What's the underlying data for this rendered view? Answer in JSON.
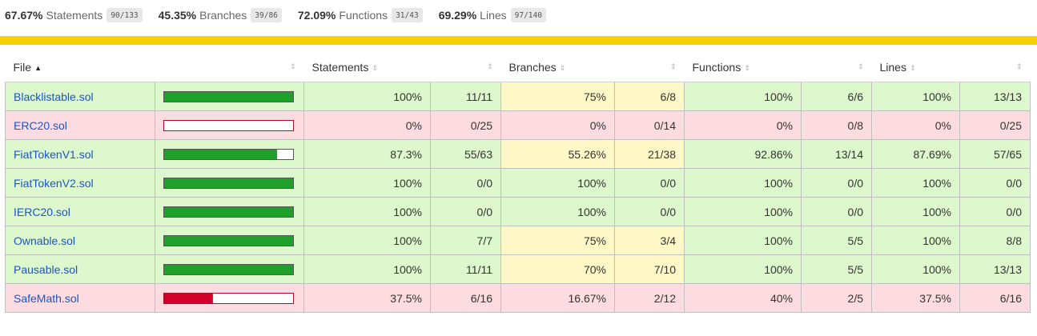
{
  "summary": [
    {
      "pct": "67.67%",
      "name": "Statements",
      "frac": "90/133"
    },
    {
      "pct": "45.35%",
      "name": "Branches",
      "frac": "39/86"
    },
    {
      "pct": "72.09%",
      "name": "Functions",
      "frac": "31/43"
    },
    {
      "pct": "69.29%",
      "name": "Lines",
      "frac": "97/140"
    }
  ],
  "status_color": "#f8d200",
  "colors": {
    "high": "#dcf8cc",
    "medium": "#fef8c6",
    "low": "#fddce1",
    "bar_high": "#1fa02a",
    "bar_low": "#d2002a",
    "link": "#1a55c7"
  },
  "table": {
    "headers": {
      "file": "File",
      "statements": "Statements",
      "branches": "Branches",
      "functions": "Functions",
      "lines": "Lines"
    },
    "sort_icons": {
      "active": "sort-ascending-icon",
      "inactive": "sort-icon"
    },
    "rows": [
      {
        "file": "Blacklistable.sol",
        "coverage": 1.0,
        "level": "high",
        "statements_pct": "100%",
        "statements_frac": "11/11",
        "statements_level": "high",
        "branches_pct": "75%",
        "branches_frac": "6/8",
        "branches_level": "medium",
        "functions_pct": "100%",
        "functions_frac": "6/6",
        "functions_level": "high",
        "lines_pct": "100%",
        "lines_frac": "13/13",
        "lines_level": "high"
      },
      {
        "file": "ERC20.sol",
        "coverage": 0.0,
        "level": "low",
        "statements_pct": "0%",
        "statements_frac": "0/25",
        "statements_level": "low",
        "branches_pct": "0%",
        "branches_frac": "0/14",
        "branches_level": "low",
        "functions_pct": "0%",
        "functions_frac": "0/8",
        "functions_level": "low",
        "lines_pct": "0%",
        "lines_frac": "0/25",
        "lines_level": "low"
      },
      {
        "file": "FiatTokenV1.sol",
        "coverage": 0.873,
        "level": "high",
        "statements_pct": "87.3%",
        "statements_frac": "55/63",
        "statements_level": "high",
        "branches_pct": "55.26%",
        "branches_frac": "21/38",
        "branches_level": "medium",
        "functions_pct": "92.86%",
        "functions_frac": "13/14",
        "functions_level": "high",
        "lines_pct": "87.69%",
        "lines_frac": "57/65",
        "lines_level": "high"
      },
      {
        "file": "FiatTokenV2.sol",
        "coverage": 1.0,
        "level": "high",
        "statements_pct": "100%",
        "statements_frac": "0/0",
        "statements_level": "high",
        "branches_pct": "100%",
        "branches_frac": "0/0",
        "branches_level": "high",
        "functions_pct": "100%",
        "functions_frac": "0/0",
        "functions_level": "high",
        "lines_pct": "100%",
        "lines_frac": "0/0",
        "lines_level": "high"
      },
      {
        "file": "IERC20.sol",
        "coverage": 1.0,
        "level": "high",
        "statements_pct": "100%",
        "statements_frac": "0/0",
        "statements_level": "high",
        "branches_pct": "100%",
        "branches_frac": "0/0",
        "branches_level": "high",
        "functions_pct": "100%",
        "functions_frac": "0/0",
        "functions_level": "high",
        "lines_pct": "100%",
        "lines_frac": "0/0",
        "lines_level": "high"
      },
      {
        "file": "Ownable.sol",
        "coverage": 1.0,
        "level": "high",
        "statements_pct": "100%",
        "statements_frac": "7/7",
        "statements_level": "high",
        "branches_pct": "75%",
        "branches_frac": "3/4",
        "branches_level": "medium",
        "functions_pct": "100%",
        "functions_frac": "5/5",
        "functions_level": "high",
        "lines_pct": "100%",
        "lines_frac": "8/8",
        "lines_level": "high"
      },
      {
        "file": "Pausable.sol",
        "coverage": 1.0,
        "level": "high",
        "statements_pct": "100%",
        "statements_frac": "11/11",
        "statements_level": "high",
        "branches_pct": "70%",
        "branches_frac": "7/10",
        "branches_level": "medium",
        "functions_pct": "100%",
        "functions_frac": "5/5",
        "functions_level": "high",
        "lines_pct": "100%",
        "lines_frac": "13/13",
        "lines_level": "high"
      },
      {
        "file": "SafeMath.sol",
        "coverage": 0.375,
        "level": "low",
        "statements_pct": "37.5%",
        "statements_frac": "6/16",
        "statements_level": "low",
        "branches_pct": "16.67%",
        "branches_frac": "2/12",
        "branches_level": "low",
        "functions_pct": "40%",
        "functions_frac": "2/5",
        "functions_level": "low",
        "lines_pct": "37.5%",
        "lines_frac": "6/16",
        "lines_level": "low"
      }
    ]
  }
}
